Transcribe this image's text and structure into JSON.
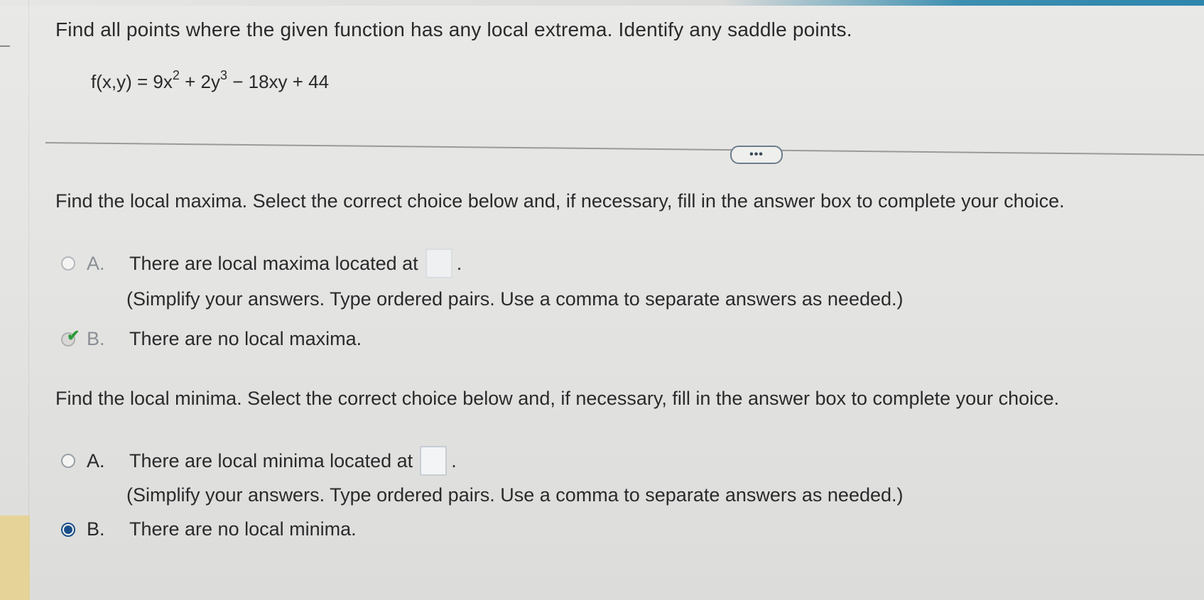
{
  "question": "Find all points where the given function has any local extrema. Identify any saddle points.",
  "function": {
    "prefix": "f(x,y) = 9x",
    "exp1": "2",
    "mid": " + 2y",
    "exp2": "3",
    "suffix": " − 18xy + 44"
  },
  "more_button": "•••",
  "maxima": {
    "title": "Find the local maxima. Select the correct choice below and, if necessary, fill in the answer box to complete your choice.",
    "option_a": {
      "letter": "A.",
      "text": "There are local maxima located at",
      "after_box": ".",
      "note": "(Simplify your answers. Type ordered pairs. Use a comma to separate answers as needed.)"
    },
    "option_b": {
      "letter": "B.",
      "text": "There are no local maxima."
    }
  },
  "minima": {
    "title": "Find the local minima. Select the correct choice below and, if necessary, fill in the answer box to complete your choice.",
    "option_a": {
      "letter": "A.",
      "text": "There are local minima located at",
      "after_box": ".",
      "note": "(Simplify your answers. Type ordered pairs. Use a comma to separate answers as needed.)"
    },
    "option_b": {
      "letter": "B.",
      "text": "There are no local minima."
    }
  }
}
